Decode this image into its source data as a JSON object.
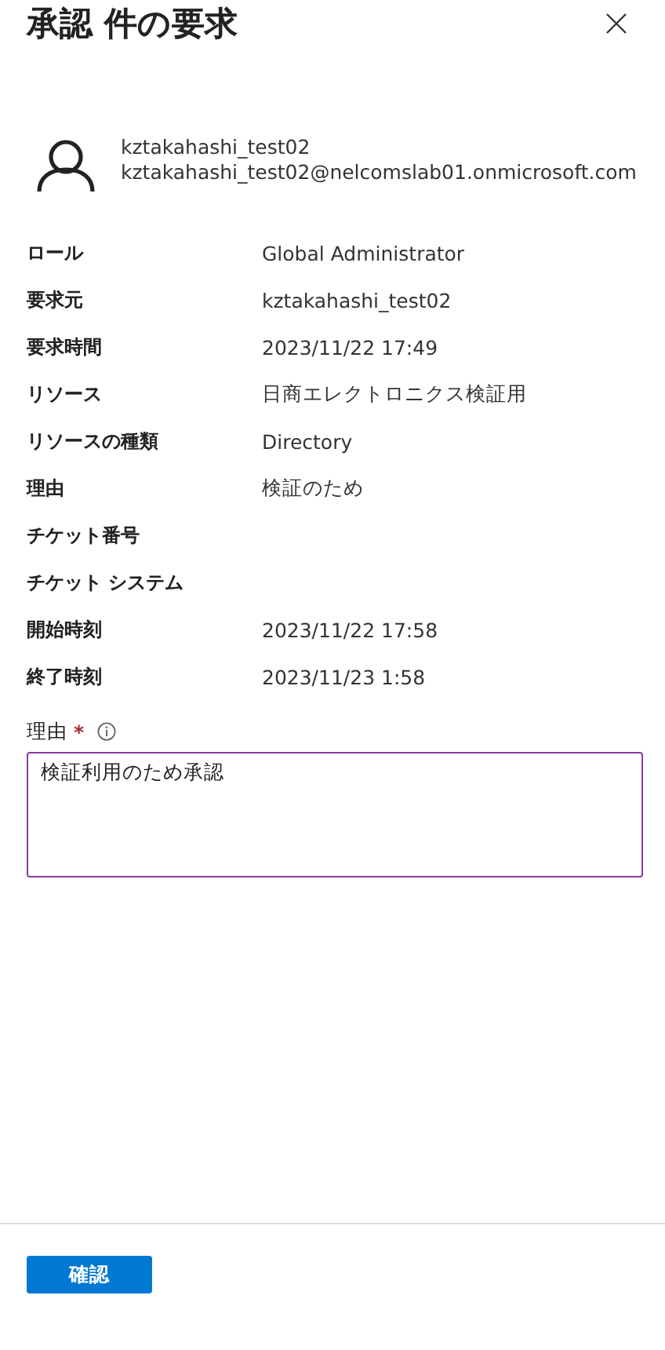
{
  "panel": {
    "title": "承認 件の要求"
  },
  "requester": {
    "name": "kztakahashi_test02",
    "email": "kztakahashi_test02@nelcomslab01.onmicrosoft.com"
  },
  "details": [
    {
      "label": "ロール",
      "value": "Global Administrator"
    },
    {
      "label": "要求元",
      "value": "kztakahashi_test02"
    },
    {
      "label": "要求時間",
      "value": "2023/11/22 17:49"
    },
    {
      "label": "リソース",
      "value": "日商エレクトロニクス検証用"
    },
    {
      "label": "リソースの種類",
      "value": "Directory"
    },
    {
      "label": "理由",
      "value": "検証のため"
    },
    {
      "label": "チケット番号"
    },
    {
      "label": "チケット システム"
    },
    {
      "label": "開始時刻",
      "value": "2023/11/22 17:58"
    },
    {
      "label": "終了時刻",
      "value": "2023/11/23 1:58"
    }
  ],
  "reason_field": {
    "label": "理由",
    "required_mark": "*",
    "value": "検証利用のため承認"
  },
  "buttons": [
    "確認"
  ]
}
